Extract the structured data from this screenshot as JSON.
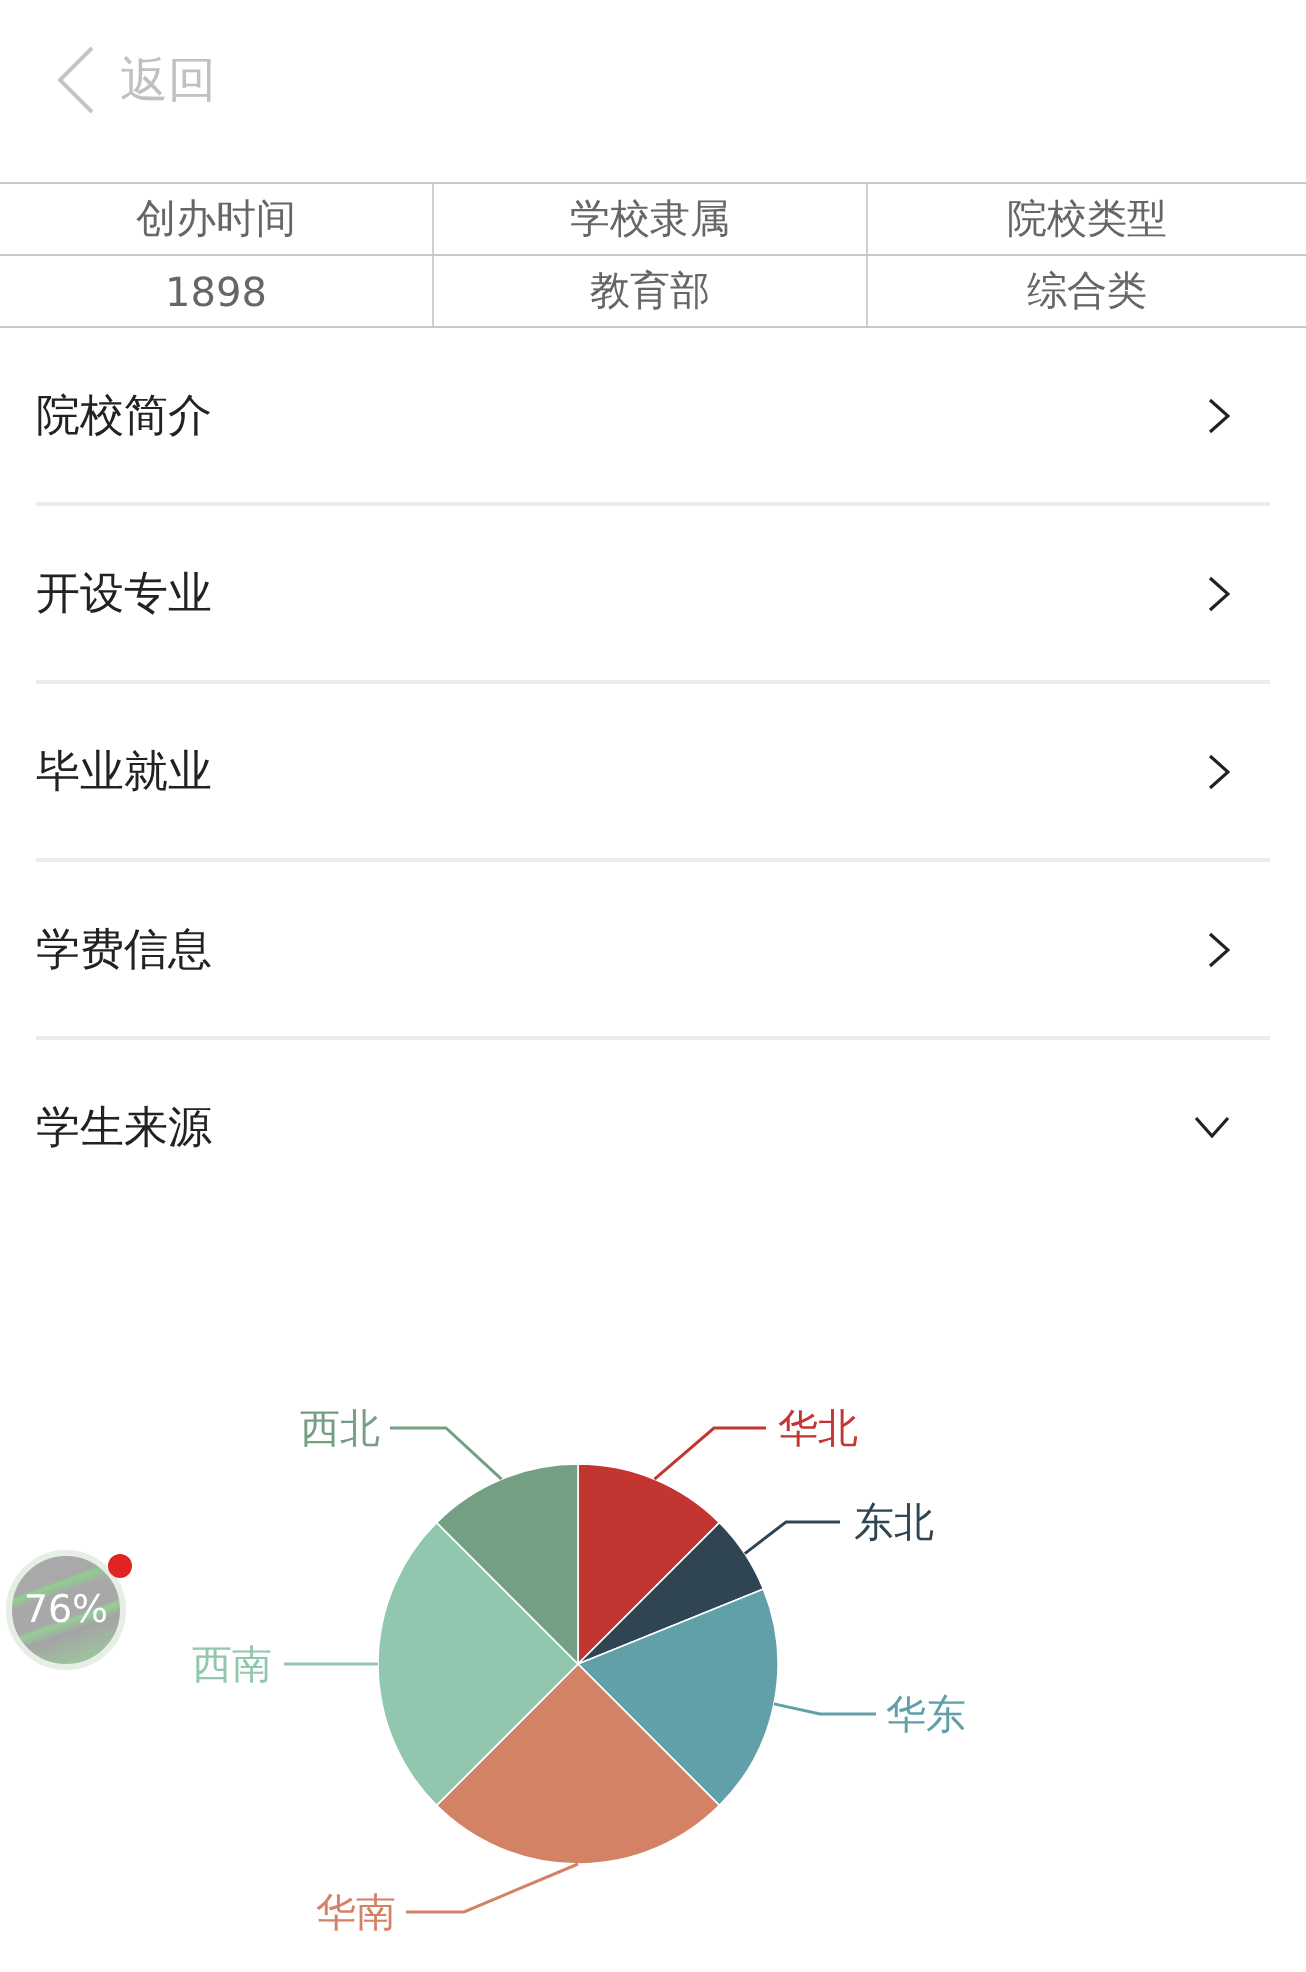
{
  "header": {
    "back_label": "返回"
  },
  "info_table": {
    "columns": [
      "创办时间",
      "学校隶属",
      "院校类型"
    ],
    "rows": [
      [
        "1898",
        "教育部",
        "综合类"
      ]
    ]
  },
  "sections": [
    {
      "title": "院校简介",
      "expanded": false
    },
    {
      "title": "开设专业",
      "expanded": false
    },
    {
      "title": "毕业就业",
      "expanded": false
    },
    {
      "title": "学费信息",
      "expanded": false
    },
    {
      "title": "学生来源",
      "expanded": true
    }
  ],
  "source_chart": {
    "slices": [
      {
        "label": "华北",
        "color": "#c23531"
      },
      {
        "label": "东北",
        "color": "#2f4554"
      },
      {
        "label": "华东",
        "color": "#61a0a8"
      },
      {
        "label": "华南",
        "color": "#d48265"
      },
      {
        "label": "西南",
        "color": "#91c7ae"
      },
      {
        "label": "西北",
        "color": "#749f83"
      }
    ]
  },
  "float_ball": {
    "text": "76%",
    "notification": true
  }
}
